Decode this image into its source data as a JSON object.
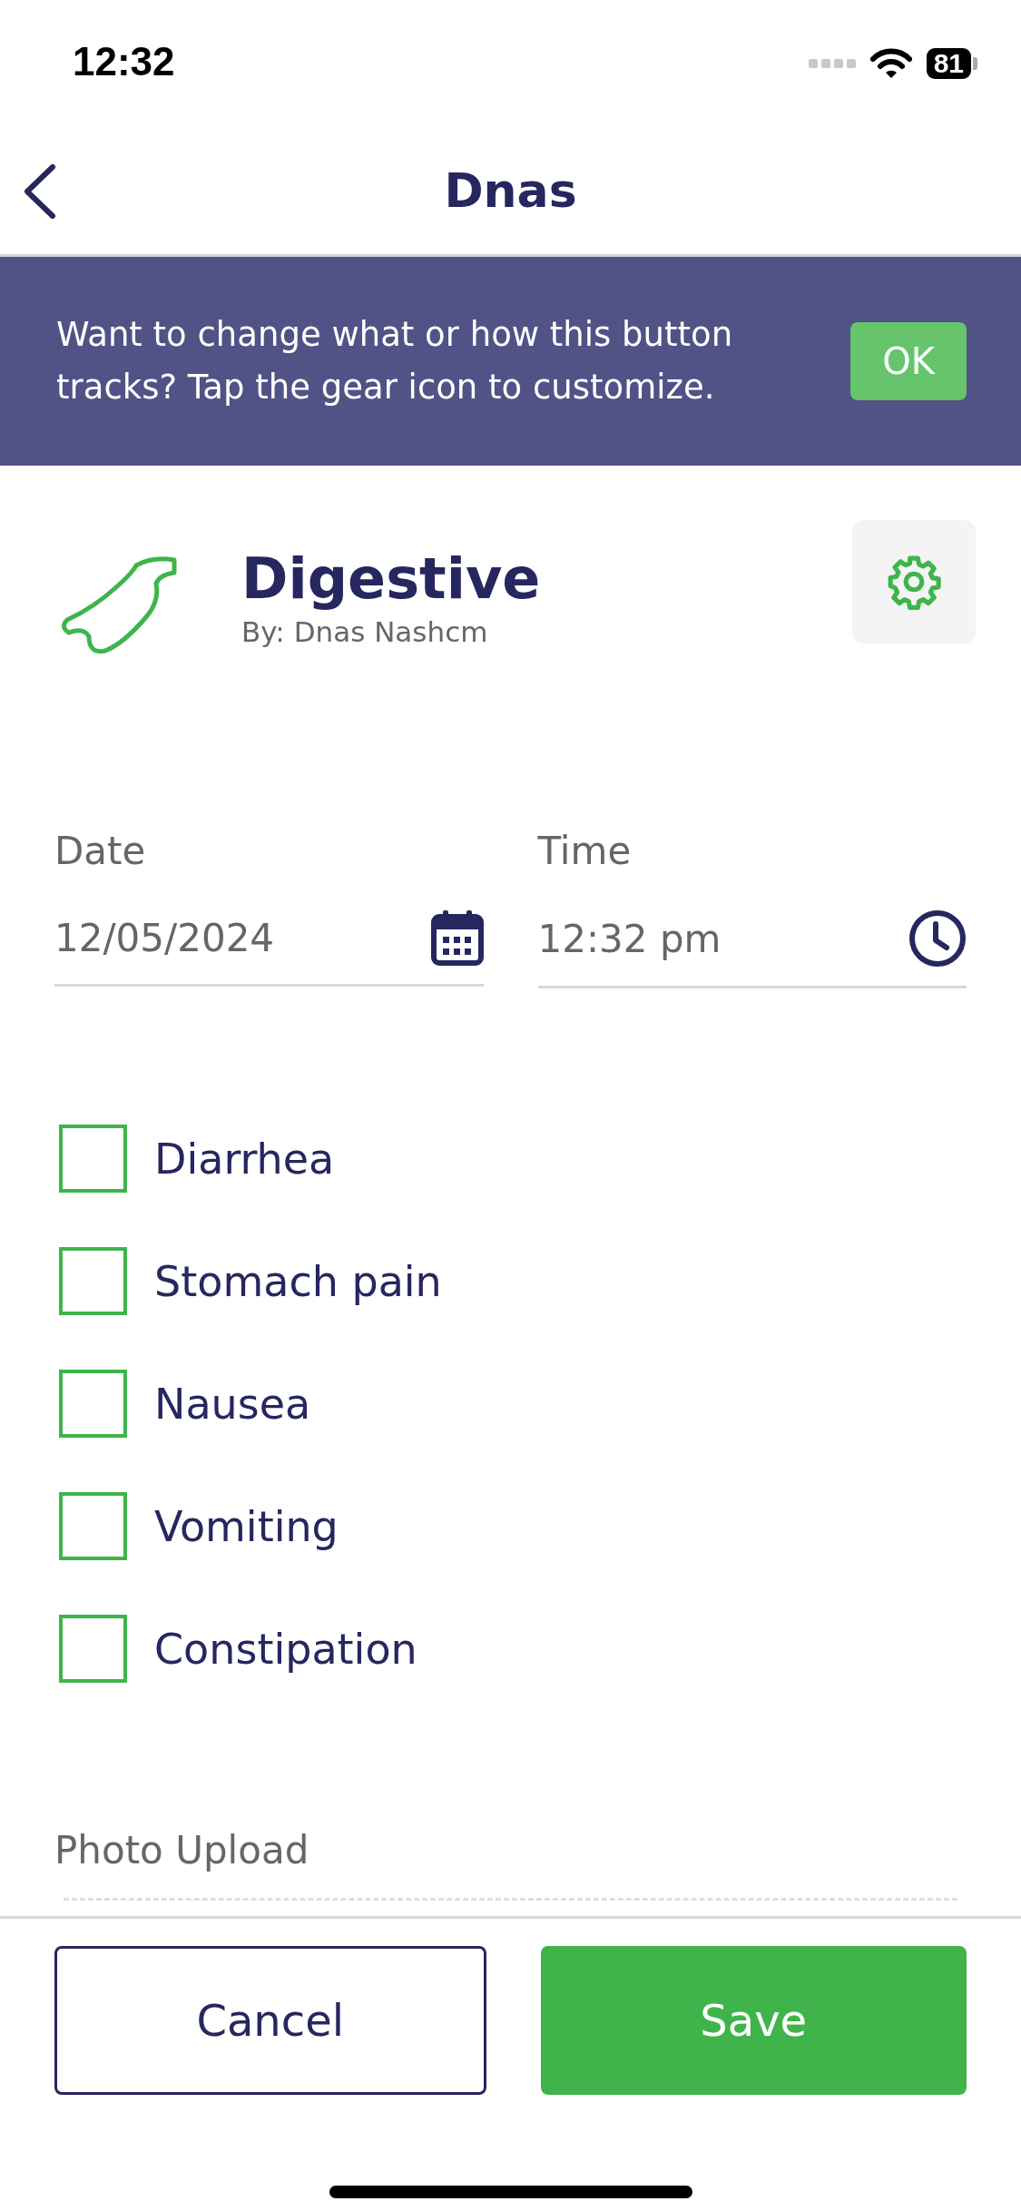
{
  "status_bar": {
    "time": "12:32",
    "battery": "81"
  },
  "nav": {
    "title": "Dnas"
  },
  "banner": {
    "message": "Want to change what or how this button tracks? Tap the gear icon to customize.",
    "button": "OK"
  },
  "tracker": {
    "title": "Digestive",
    "author": "By: Dnas Nashcm"
  },
  "date": {
    "label": "Date",
    "value": "12/05/2024"
  },
  "time": {
    "label": "Time",
    "value": "12:32 pm"
  },
  "symptoms": [
    {
      "label": "Diarrhea",
      "checked": false
    },
    {
      "label": "Stomach pain",
      "checked": false
    },
    {
      "label": "Nausea",
      "checked": false
    },
    {
      "label": "Vomiting",
      "checked": false
    },
    {
      "label": "Constipation",
      "checked": false
    }
  ],
  "photo_upload": {
    "label": "Photo Upload"
  },
  "buttons": {
    "cancel": "Cancel",
    "save": "Save"
  }
}
